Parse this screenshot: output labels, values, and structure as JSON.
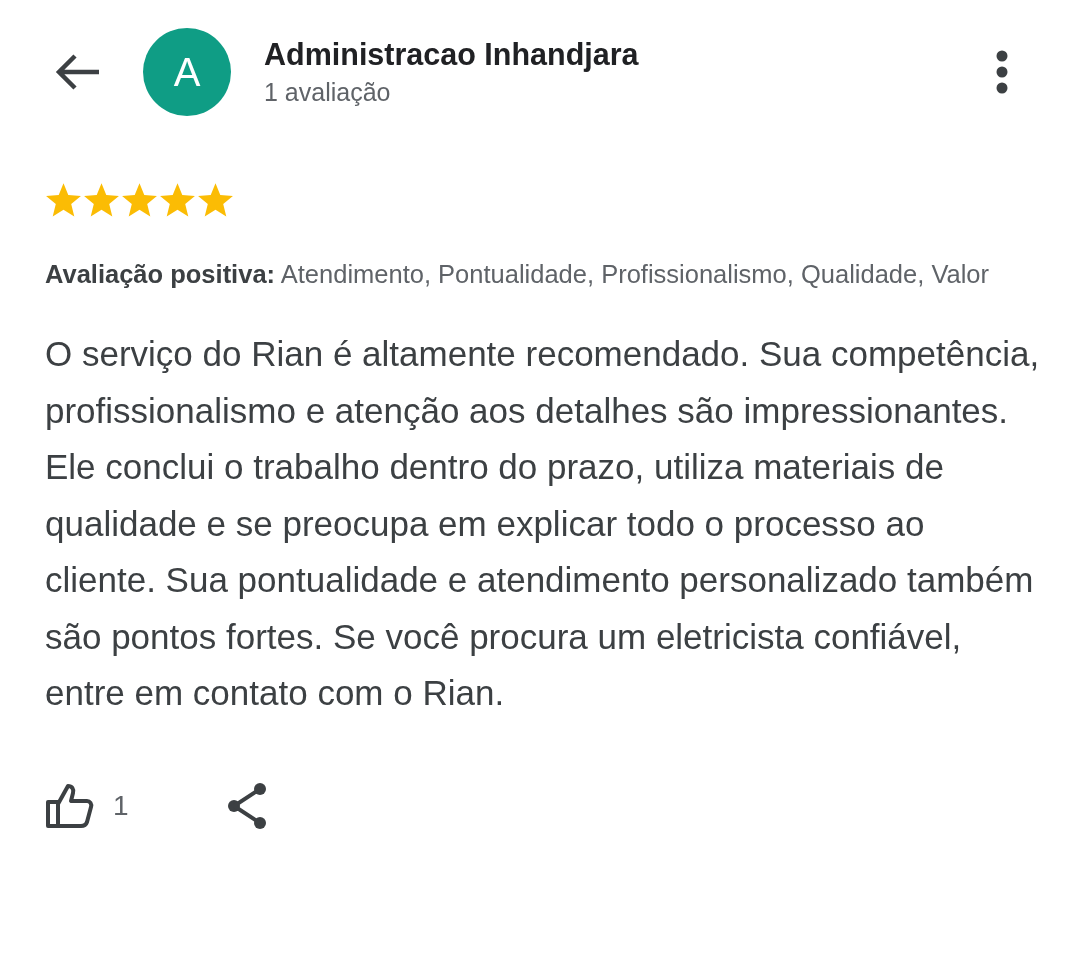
{
  "header": {
    "avatar_letter": "A",
    "name": "Administracao Inhandjara",
    "subtitle": "1 avaliação"
  },
  "review": {
    "stars": 5,
    "positive": "**Avaliação positiva:** Atendimento, Pontualidade, Profissionalismo, Qualidade, Valor",
    "text": "O serviço do Rian é altamente recomendado. Sua competência, profissionalismo e atenção aos detalhes são impressionantes. Ele conclui o trabalho dentro do prazo, utiliza materiais de qualidade e se preocupa em explicar todo o processo ao cliente. Sua pontualidade e atendimento personalizado também são pontos fortes. Se você procura um eletricista confiável, entre em contato com o Rian."
  },
  "actions": {
    "likes": "1"
  }
}
